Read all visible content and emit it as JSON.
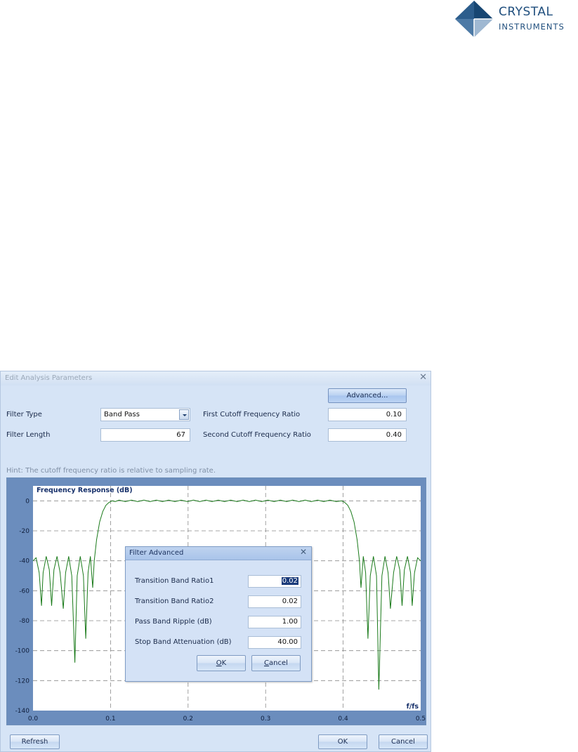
{
  "logo": {
    "line1": "CRYSTAL",
    "line2": "INSTRUMENTS"
  },
  "dialog": {
    "title": "Edit Analysis Parameters",
    "close_glyph": "✕",
    "advanced_label": "Advanced...",
    "filter_type_label": "Filter Type",
    "filter_type_value": "Band Pass",
    "filter_length_label": "Filter Length",
    "filter_length_value": "67",
    "first_cutoff_label": "First Cutoff Frequency Ratio",
    "first_cutoff_value": "0.10",
    "second_cutoff_label": "Second Cutoff Frequency Ratio",
    "second_cutoff_value": "0.40",
    "hint": "Hint: The cutoff frequency ratio is relative to sampling rate.",
    "refresh_label": "Refresh",
    "ok_label": "OK",
    "cancel_label": "Cancel"
  },
  "chart_data": {
    "type": "line",
    "title": "Frequency Response (dB)",
    "xlabel": "f/fs",
    "xlim": [
      0.0,
      0.5
    ],
    "ylim": [
      -140,
      10
    ],
    "x_ticks": [
      "0.0",
      "0.1",
      "0.2",
      "0.3",
      "0.4",
      "0.5"
    ],
    "y_ticks": [
      "0",
      "-20",
      "-40",
      "-60",
      "-80",
      "-100",
      "-120",
      "-140"
    ],
    "grid": true,
    "series": [
      {
        "color": "#1a7a1a",
        "points": [
          [
            0.0,
            -40
          ],
          [
            0.004,
            -38
          ],
          [
            0.008,
            -48
          ],
          [
            0.011,
            -70
          ],
          [
            0.013,
            -48
          ],
          [
            0.017,
            -37
          ],
          [
            0.021,
            -46
          ],
          [
            0.024,
            -70
          ],
          [
            0.027,
            -46
          ],
          [
            0.031,
            -37
          ],
          [
            0.035,
            -48
          ],
          [
            0.039,
            -72
          ],
          [
            0.042,
            -48
          ],
          [
            0.046,
            -37
          ],
          [
            0.05,
            -50
          ],
          [
            0.054,
            -108
          ],
          [
            0.057,
            -50
          ],
          [
            0.061,
            -37
          ],
          [
            0.065,
            -50
          ],
          [
            0.068,
            -92
          ],
          [
            0.071,
            -48
          ],
          [
            0.074,
            -37
          ],
          [
            0.077,
            -58
          ],
          [
            0.079,
            -40
          ],
          [
            0.082,
            -26
          ],
          [
            0.086,
            -14
          ],
          [
            0.09,
            -7
          ],
          [
            0.094,
            -3
          ],
          [
            0.098,
            -1
          ],
          [
            0.102,
            0
          ],
          [
            0.106,
            -0.5
          ],
          [
            0.111,
            0.5
          ],
          [
            0.119,
            -0.5
          ],
          [
            0.127,
            0.5
          ],
          [
            0.135,
            -0.5
          ],
          [
            0.143,
            0.5
          ],
          [
            0.151,
            -0.5
          ],
          [
            0.159,
            0.5
          ],
          [
            0.167,
            -0.5
          ],
          [
            0.175,
            0.5
          ],
          [
            0.183,
            -0.5
          ],
          [
            0.191,
            0.5
          ],
          [
            0.199,
            -0.5
          ],
          [
            0.207,
            0.5
          ],
          [
            0.215,
            -0.5
          ],
          [
            0.223,
            0.5
          ],
          [
            0.231,
            -0.5
          ],
          [
            0.239,
            0.5
          ],
          [
            0.247,
            -0.5
          ],
          [
            0.255,
            0.5
          ],
          [
            0.263,
            -0.5
          ],
          [
            0.271,
            0.5
          ],
          [
            0.279,
            -0.5
          ],
          [
            0.287,
            0.5
          ],
          [
            0.295,
            -0.5
          ],
          [
            0.303,
            0.5
          ],
          [
            0.311,
            -0.5
          ],
          [
            0.319,
            0.5
          ],
          [
            0.327,
            -0.5
          ],
          [
            0.335,
            0.5
          ],
          [
            0.343,
            -0.5
          ],
          [
            0.351,
            0.5
          ],
          [
            0.359,
            -0.5
          ],
          [
            0.367,
            0.5
          ],
          [
            0.375,
            -0.5
          ],
          [
            0.383,
            0.5
          ],
          [
            0.391,
            -0.5
          ],
          [
            0.398,
            0
          ],
          [
            0.402,
            -1
          ],
          [
            0.406,
            -3
          ],
          [
            0.41,
            -7
          ],
          [
            0.414,
            -14
          ],
          [
            0.418,
            -26
          ],
          [
            0.421,
            -40
          ],
          [
            0.423,
            -58
          ],
          [
            0.426,
            -37
          ],
          [
            0.429,
            -48
          ],
          [
            0.432,
            -92
          ],
          [
            0.435,
            -50
          ],
          [
            0.439,
            -37
          ],
          [
            0.443,
            -50
          ],
          [
            0.446,
            -126
          ],
          [
            0.45,
            -50
          ],
          [
            0.454,
            -37
          ],
          [
            0.458,
            -48
          ],
          [
            0.461,
            -72
          ],
          [
            0.465,
            -48
          ],
          [
            0.469,
            -37
          ],
          [
            0.473,
            -46
          ],
          [
            0.476,
            -70
          ],
          [
            0.479,
            -46
          ],
          [
            0.483,
            -37
          ],
          [
            0.487,
            -48
          ],
          [
            0.489,
            -70
          ],
          [
            0.492,
            -48
          ],
          [
            0.496,
            -38
          ],
          [
            0.5,
            -40
          ]
        ]
      }
    ]
  },
  "advanced": {
    "title": "Filter Advanced",
    "close_glyph": "✕",
    "tb1_label": "Transition Band Ratio1",
    "tb1_value": "0.02",
    "tb2_label": "Transition Band Ratio2",
    "tb2_value": "0.02",
    "ripple_label": "Pass Band Ripple (dB)",
    "ripple_value": "1.00",
    "atten_label": "Stop Band Attenuation (dB)",
    "atten_value": "40.00",
    "ok_mnemonic": "O",
    "ok_rest": "K",
    "cancel_mnemonic": "C",
    "cancel_rest": "ancel"
  }
}
